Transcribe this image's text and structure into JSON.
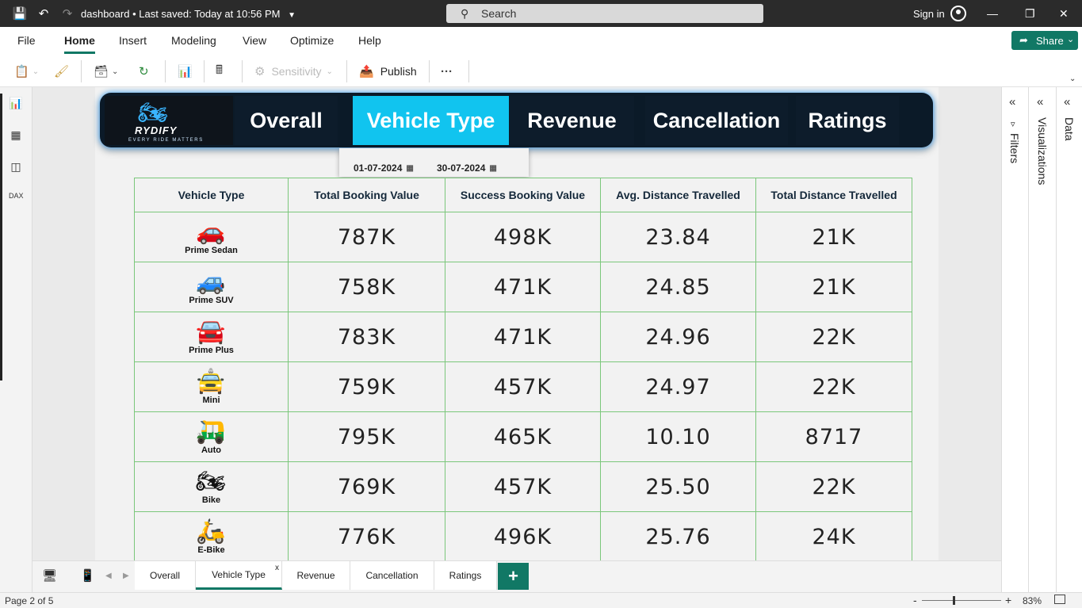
{
  "titlebar": {
    "file_name": "dashboard",
    "saved_status": "Last saved: Today at 10:56 PM",
    "search_placeholder": "Search",
    "sign_in": "Sign in"
  },
  "menu": {
    "items": [
      "File",
      "Home",
      "Insert",
      "Modeling",
      "View",
      "Optimize",
      "Help"
    ],
    "active": "Home",
    "share": "Share"
  },
  "ribbon": {
    "sensitivity": "Sensitivity",
    "publish": "Publish",
    "more": "···"
  },
  "nav": {
    "brand": "RYDIFY",
    "tagline": "EVERY RIDE MATTERS",
    "tabs": [
      "Overall",
      "Vehicle Type",
      "Revenue",
      "Cancellation",
      "Ratings"
    ],
    "active_tab": "Vehicle Type",
    "active_color": "#11c4ef"
  },
  "date_range": {
    "start": "01-07-2024",
    "end": "30-07-2024"
  },
  "table": {
    "headers": [
      "Vehicle Type",
      "Total Booking Value",
      "Success Booking Value",
      "Avg. Distance Travelled",
      "Total Distance Travelled"
    ],
    "rows": [
      {
        "vehicle": "Prime Sedan",
        "icon": "sedan-icon",
        "total_booking": "787K",
        "success_booking": "498K",
        "avg_distance": "23.84",
        "total_distance": "21K"
      },
      {
        "vehicle": "Prime SUV",
        "icon": "suv-icon",
        "total_booking": "758K",
        "success_booking": "471K",
        "avg_distance": "24.85",
        "total_distance": "21K"
      },
      {
        "vehicle": "Prime Plus",
        "icon": "car-icon",
        "total_booking": "783K",
        "success_booking": "471K",
        "avg_distance": "24.96",
        "total_distance": "22K"
      },
      {
        "vehicle": "Mini",
        "icon": "mini-car-icon",
        "total_booking": "759K",
        "success_booking": "457K",
        "avg_distance": "24.97",
        "total_distance": "22K"
      },
      {
        "vehicle": "Auto",
        "icon": "auto-rickshaw-icon",
        "total_booking": "795K",
        "success_booking": "465K",
        "avg_distance": "10.10",
        "total_distance": "8717"
      },
      {
        "vehicle": "Bike",
        "icon": "motorbike-icon",
        "total_booking": "769K",
        "success_booking": "457K",
        "avg_distance": "25.50",
        "total_distance": "22K"
      },
      {
        "vehicle": "E-Bike",
        "icon": "scooter-icon",
        "total_booking": "776K",
        "success_booking": "496K",
        "avg_distance": "25.76",
        "total_distance": "24K"
      }
    ]
  },
  "right_panes": {
    "filters": "Filters",
    "visualizations": "Visualizations",
    "data": "Data"
  },
  "page_tabs": {
    "tabs": [
      "Overall",
      "Vehicle Type",
      "Revenue",
      "Cancellation",
      "Ratings"
    ],
    "active": "Vehicle Type",
    "close": "x",
    "add": "+"
  },
  "status": {
    "page": "Page 2 of 5",
    "zoom": "83%"
  },
  "colors": {
    "accent": "#117865",
    "nav_bg": "#0b1a28",
    "table_border": "#7bc77b"
  }
}
